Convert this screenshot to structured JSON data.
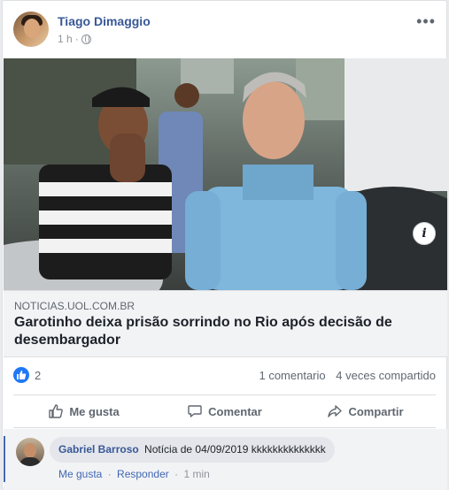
{
  "post": {
    "author": "Tiago Dimaggio",
    "time": "1 h",
    "separator": "·",
    "more_glyph": "•••"
  },
  "link": {
    "domain": "NOTICIAS.UOL.COM.BR",
    "title": "Garotinho deixa prisão sorrindo no Rio após decisão de desembargador",
    "info_glyph": "i"
  },
  "stats": {
    "likes": "2",
    "comments": "1 comentario",
    "shares": "4 veces compartido"
  },
  "actions": {
    "like": "Me gusta",
    "comment": "Comentar",
    "share": "Compartir"
  },
  "comment": {
    "author": "Gabriel Barroso",
    "text": "Notícia de 04/09/2019 kkkkkkkkkkkkkk",
    "like": "Me gusta",
    "reply": "Responder",
    "time": "1 min",
    "dot": "·"
  },
  "colors": {
    "link_blue": "#385898",
    "like_blue": "#2078f4",
    "muted": "#606770"
  }
}
